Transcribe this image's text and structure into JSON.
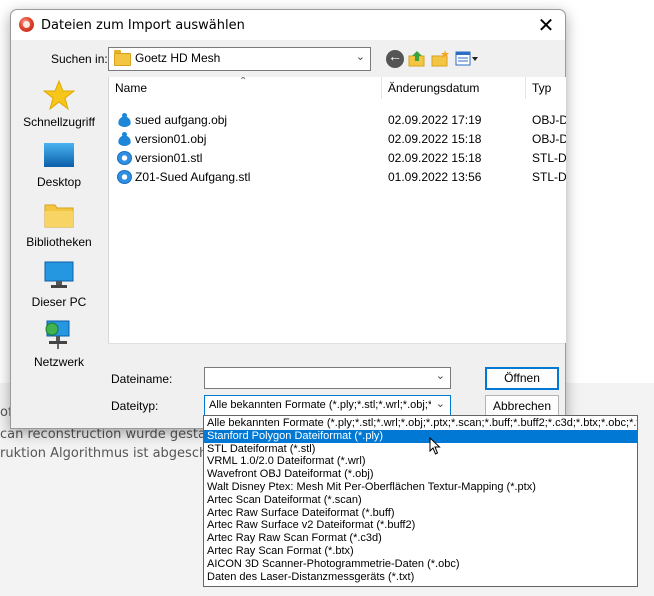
{
  "dialog": {
    "title": "Dateien zum Import auswählen",
    "close_glyph": "✕",
    "look_in_label": "Suchen in:",
    "look_in_value": "Goetz HD Mesh",
    "places": [
      {
        "label": "Schnellzugriff",
        "icon": "star-icon"
      },
      {
        "label": "Desktop",
        "icon": "desktop-icon"
      },
      {
        "label": "Bibliotheken",
        "icon": "folder-icon"
      },
      {
        "label": "Dieser PC",
        "icon": "computer-icon"
      },
      {
        "label": "Netzwerk",
        "icon": "network-icon"
      }
    ],
    "columns": {
      "name": "Name",
      "date": "Änderungsdatum",
      "type": "Typ"
    },
    "files": [
      {
        "name": "sued aufgang.obj",
        "date": "02.09.2022 17:19",
        "type": "OBJ-D",
        "icon": "obj-file-icon"
      },
      {
        "name": "version01.obj",
        "date": "02.09.2022 15:18",
        "type": "OBJ-D",
        "icon": "obj-file-icon"
      },
      {
        "name": "version01.stl",
        "date": "02.09.2022 15:18",
        "type": "STL-D",
        "icon": "stl-file-icon"
      },
      {
        "name": "Z01-Sued Aufgang.stl",
        "date": "01.09.2022 13:56",
        "type": "STL-D",
        "icon": "stl-file-icon"
      }
    ],
    "filename_label": "Dateiname:",
    "filename_value": "",
    "filetype_label": "Dateityp:",
    "filetype_value": "Alle bekannten Formate (*.ply;*.stl;*.wrl;*.obj;*.pt",
    "open_label": "Öffnen",
    "cancel_label": "Abbrechen"
  },
  "filetype_options": [
    "Alle bekannten Formate (*.ply;*.stl;*.wrl;*.obj;*.ptx;*.scan;*.buff;*.buff2;*.c3d;*.btx;*.obc;*.txt)",
    "Stanford Polygon Dateiformat (*.ply)",
    "STL Dateiformat (*.stl)",
    "VRML 1.0/2.0 Dateiformat (*.wrl)",
    "Wavefront OBJ Dateiformat (*.obj)",
    "Walt Disney Ptex: Mesh Mit Per-Oberflächen Textur-Mapping (*.ptx)",
    "Artec Scan Dateiformat (*.scan)",
    "Artec Raw Surface Dateiformat (*.buff)",
    "Artec Raw Surface v2 Dateiformat (*.buff2)",
    "Artec Ray Raw Scan Format (*.c3d)",
    "Artec Ray Scan Format (*.btx)",
    "AICON 3D Scanner-Photogrammetrie-Daten (*.obc)",
    "Daten des Laser-Distanzmessgeräts (*.txt)"
  ],
  "selected_option_index": 1,
  "background": {
    "lines": [
      "of",
      "can reconstruction wurde gestartet",
      "ruktion Algorithmus ist abgeschlosse"
    ]
  },
  "colors": {
    "accent": "#0078d4",
    "dialog_bg": "#f0f0f0"
  }
}
